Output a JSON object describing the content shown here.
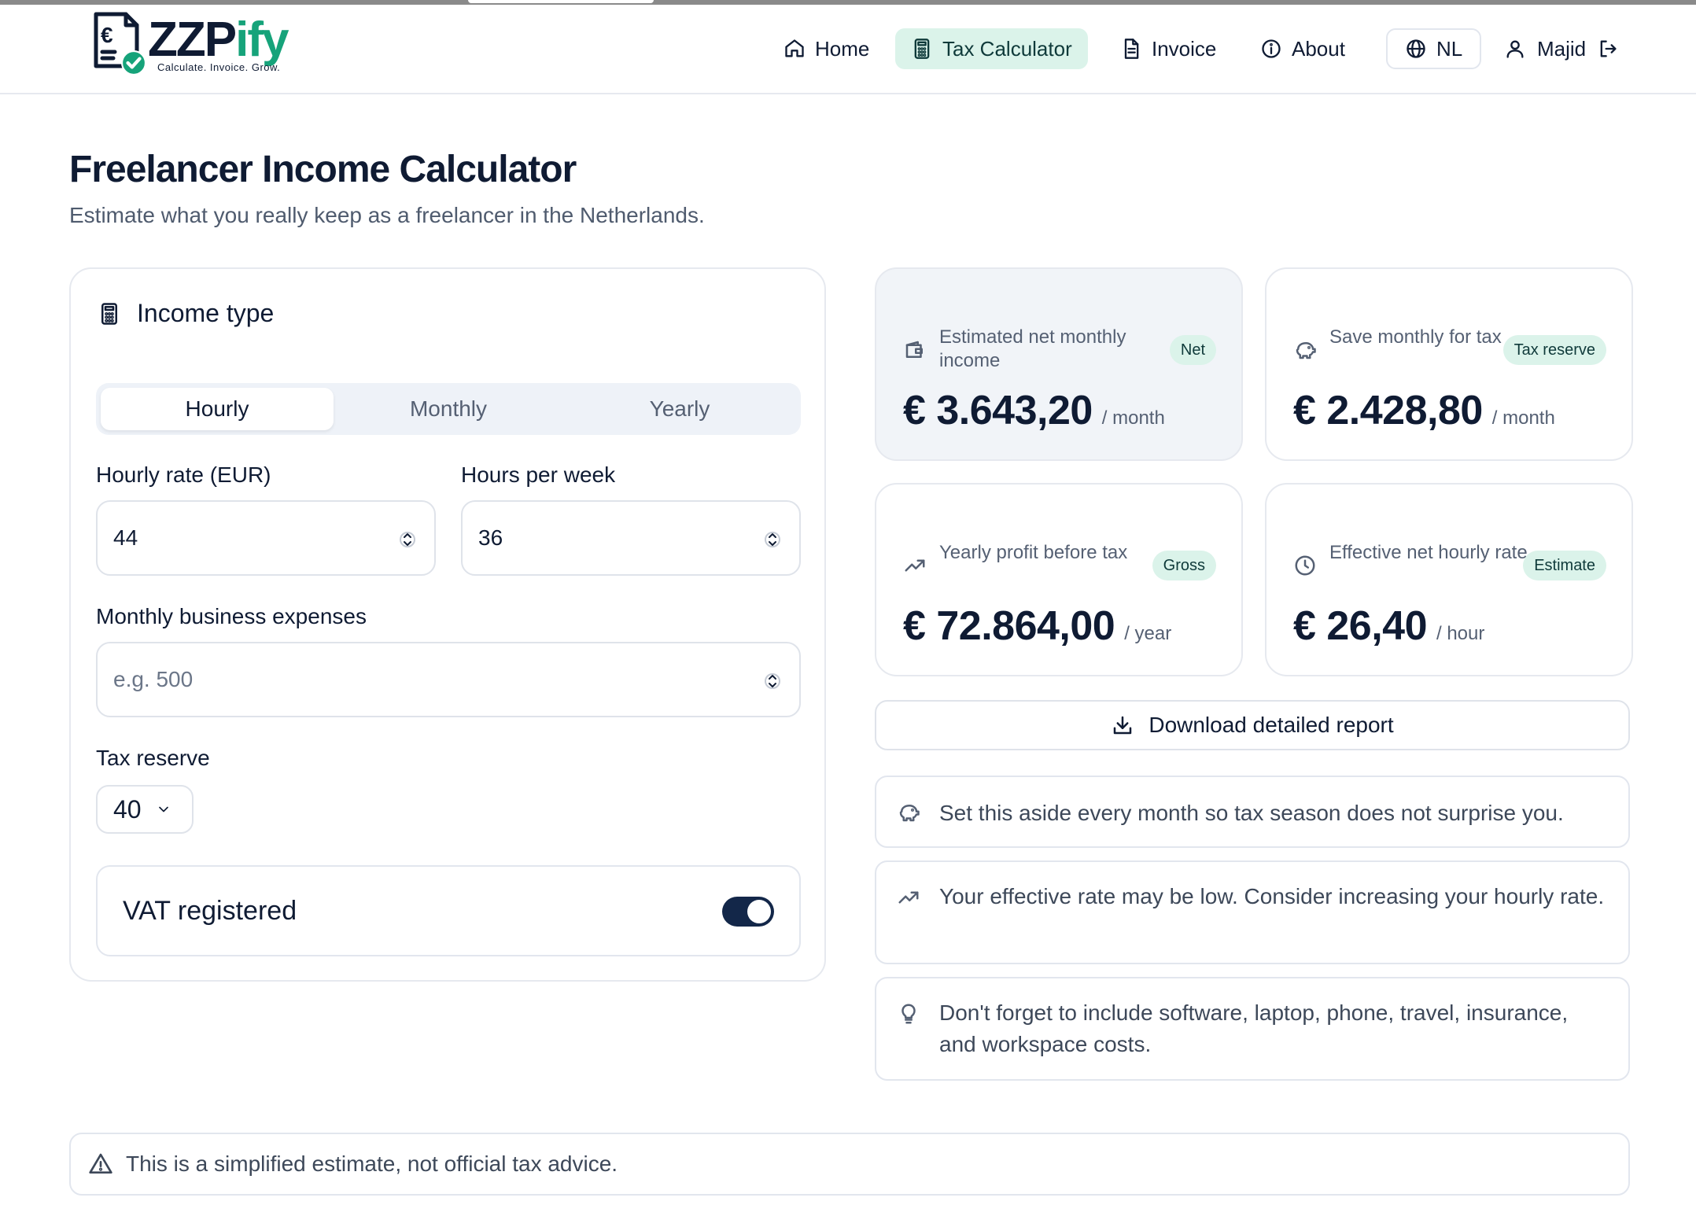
{
  "brand": {
    "name_part1": "ZZP",
    "name_part2": "ify",
    "tagline": "Calculate. Invoice. Grow.",
    "primary_color": "#0f1b33",
    "accent_color": "#16a37a"
  },
  "nav": {
    "home": "Home",
    "tax_calculator": "Tax Calculator",
    "invoice": "Invoice",
    "about": "About",
    "language": "NL",
    "user": "Majid",
    "active": "tax_calculator"
  },
  "page": {
    "title": "Freelancer Income Calculator",
    "subtitle": "Estimate what you really keep as a freelancer in the Netherlands."
  },
  "form": {
    "section_title": "Income type",
    "income_types": [
      "Hourly",
      "Monthly",
      "Yearly"
    ],
    "selected_income_type": "Hourly",
    "hourly_rate_label": "Hourly rate (EUR)",
    "hourly_rate_value": "44",
    "hours_per_week_label": "Hours per week",
    "hours_per_week_value": "36",
    "expenses_label": "Monthly business expenses",
    "expenses_placeholder": "e.g. 500",
    "tax_reserve_label": "Tax reserve",
    "tax_reserve_value": "40",
    "vat_label": "VAT registered",
    "vat_on": true
  },
  "stats": {
    "net_monthly": {
      "label": "Estimated net monthly income",
      "badge": "Net",
      "value": "€ 3.643,20",
      "unit": "/ month"
    },
    "save_monthly": {
      "label": "Save monthly for tax",
      "badge": "Tax reserve",
      "value": "€ 2.428,80",
      "unit": "/ month"
    },
    "yearly_profit": {
      "label": "Yearly profit before tax",
      "badge": "Gross",
      "value": "€ 72.864,00",
      "unit": "/ year"
    },
    "net_hourly": {
      "label": "Effective net hourly rate",
      "badge": "Estimate",
      "value": "€ 26,40",
      "unit": "/ hour"
    }
  },
  "download_label": "Download detailed report",
  "tips": [
    "Set this aside every month so tax season does not surprise you.",
    "Your effective rate may be low. Consider increasing your hourly rate.",
    "Don't forget to include software, laptop, phone, travel, insurance, and workspace costs."
  ],
  "disclaimer": "This is a simplified estimate, not official tax advice."
}
